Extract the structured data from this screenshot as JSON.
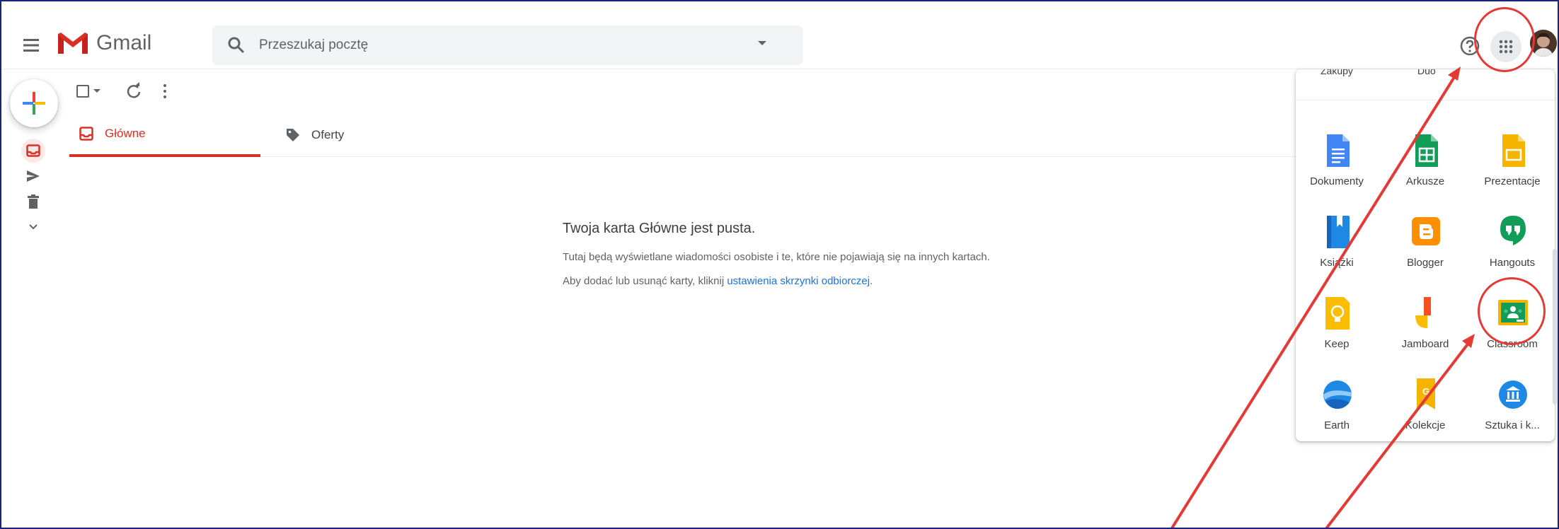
{
  "header": {
    "app_name": "Gmail",
    "search_placeholder": "Przeszukaj pocztę"
  },
  "tabs": [
    {
      "label": "Główne",
      "active": true
    },
    {
      "label": "Oferty",
      "active": false
    }
  ],
  "empty_state": {
    "title": "Twoja karta Główne jest pusta.",
    "line1": "Tutaj będą wyświetlane wiadomości osobiste i te, które nie pojawiają się na innych kartach.",
    "line2_prefix": "Aby dodać lub usunąć karty, kliknij ",
    "line2_link": "ustawienia skrzynki odbiorczej",
    "line2_suffix": "."
  },
  "apps_panel": {
    "partial_top": [
      "Zakupy",
      "Duo"
    ],
    "apps": [
      {
        "label": "Dokumenty",
        "icon": "docs-icon"
      },
      {
        "label": "Arkusze",
        "icon": "sheets-icon"
      },
      {
        "label": "Prezentacje",
        "icon": "slides-icon"
      },
      {
        "label": "Książki",
        "icon": "books-icon"
      },
      {
        "label": "Blogger",
        "icon": "blogger-icon"
      },
      {
        "label": "Hangouts",
        "icon": "hangouts-icon"
      },
      {
        "label": "Keep",
        "icon": "keep-icon"
      },
      {
        "label": "Jamboard",
        "icon": "jamboard-icon"
      },
      {
        "label": "Classroom",
        "icon": "classroom-icon"
      },
      {
        "label": "Earth",
        "icon": "earth-icon"
      },
      {
        "label": "Kolekcje",
        "icon": "collections-icon"
      },
      {
        "label": "Sztuka i k...",
        "icon": "arts-culture-icon"
      }
    ]
  },
  "colors": {
    "accent_red": "#d93025",
    "annotation_red": "#e53935",
    "link_blue": "#1a73e8"
  }
}
